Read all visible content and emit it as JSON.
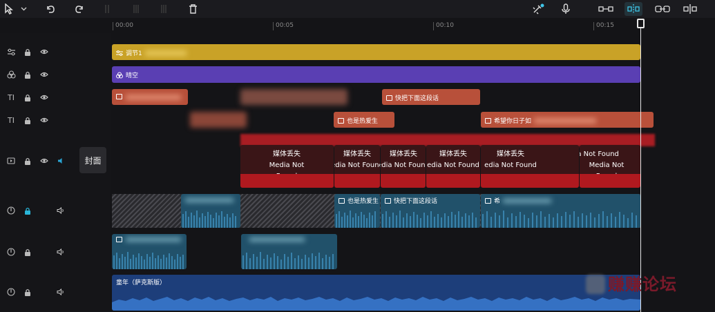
{
  "toolbar": {
    "icons": [
      "pointer-icon",
      "chevron-down-icon",
      "undo-icon",
      "redo-icon",
      "split-icon",
      "split-left-icon",
      "split-right-icon",
      "delete-icon",
      "ai-magic-icon",
      "microphone-icon",
      "link-clips-icon",
      "snap-icon",
      "linkage-icon",
      "preview-axis-icon"
    ]
  },
  "ruler": {
    "ticks": [
      "00:00",
      "00:05",
      "00:10",
      "00:15"
    ]
  },
  "cover": {
    "label": "封面"
  },
  "tracks": {
    "adjust": {
      "label": "调节1",
      "color": "#c9a227"
    },
    "effect": {
      "label": "晴空",
      "color": "#5a3fb3"
    },
    "text1": {
      "clip": "快把下面这段话"
    },
    "text2": {
      "clip1": "也是热爱生",
      "clip2": "希望你日子如"
    },
    "video": {
      "mnf_cn": "媒体丢失",
      "mnf_en": "Media Not Found",
      "mnf_clip2_en": "edia Not Found",
      "mnf_clip3_en": "edia Not Found"
    },
    "audio1": {
      "clip1": "也是热爱生",
      "clip2": "快把下面这段话",
      "clip3": "希"
    },
    "music": {
      "label": "童年（萨克斯版）"
    }
  },
  "watermark": {
    "text": "赚赚论坛"
  }
}
